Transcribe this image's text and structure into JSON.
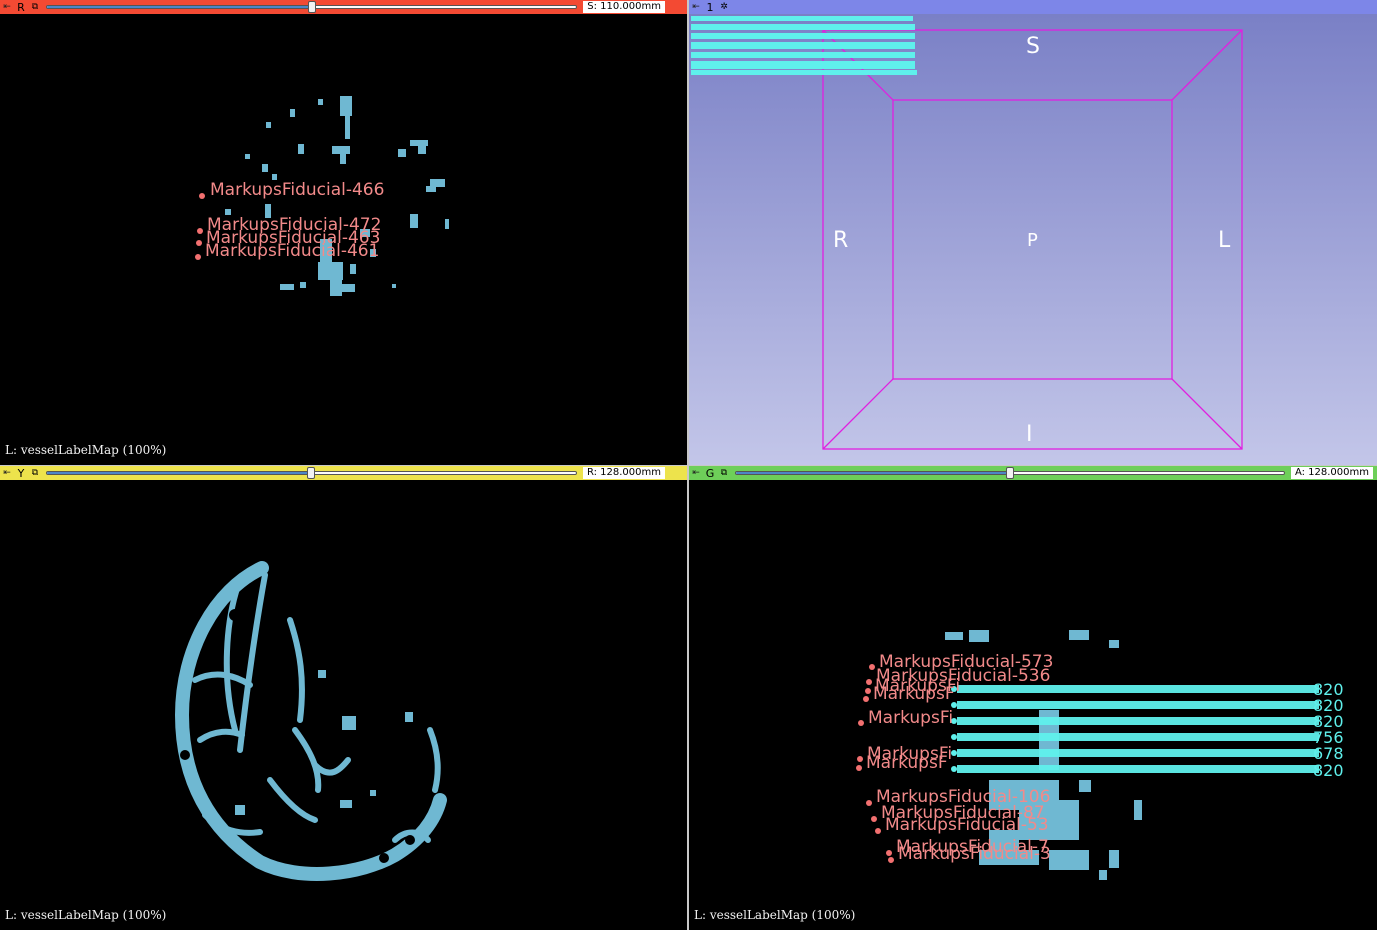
{
  "red_viewer": {
    "letter": "R",
    "offset": "S: 110.000mm",
    "slider_fraction": 0.5,
    "label": "L: vesselLabelMap (100%)",
    "fiducials": [
      "MarkupsFiducial-466",
      "MarkupsFiducial-472",
      "MarkupsFiducial-463",
      "MarkupsFiducial-461"
    ]
  },
  "view3d": {
    "number": "1",
    "orientation": {
      "top": "S",
      "left": "R",
      "right": "L",
      "center": "P",
      "bottom": "I"
    }
  },
  "yellow_viewer": {
    "letter": "Y",
    "offset": "R: 128.000mm",
    "slider_fraction": 0.5,
    "label": "L: vesselLabelMap (100%)"
  },
  "green_viewer": {
    "letter": "G",
    "offset": "A: 128.000mm",
    "slider_fraction": 0.5,
    "label": "L: vesselLabelMap (100%)",
    "fiducials": [
      "MarkupsFiducial-573",
      "MarkupsFiducial-536",
      "MarkupsFi",
      "MarkupsF",
      "MarkupsFi",
      "MarkupsFi",
      "MarkupsF",
      "MarkupsFiducial-106",
      "MarkupsFiducial-87",
      "MarkupsFiducial-53",
      "MarkupsFiducial-7",
      "MarkupsFiducial-3"
    ],
    "cyan_suffixes": [
      "820",
      "820",
      "820",
      "756",
      "678",
      "820"
    ]
  },
  "colors": {
    "red": "#f34a33",
    "yellow": "#ede34c",
    "green": "#6ecf59",
    "blue3d": "#7d86e8",
    "vessel": "#6fb8d2",
    "fiducial": "#f28a8a",
    "cyan": "#5ff0ec",
    "box": "#e020e0"
  },
  "icons": {
    "pin": "pin-icon",
    "link": "link-icon",
    "settings": "gear-icon"
  }
}
